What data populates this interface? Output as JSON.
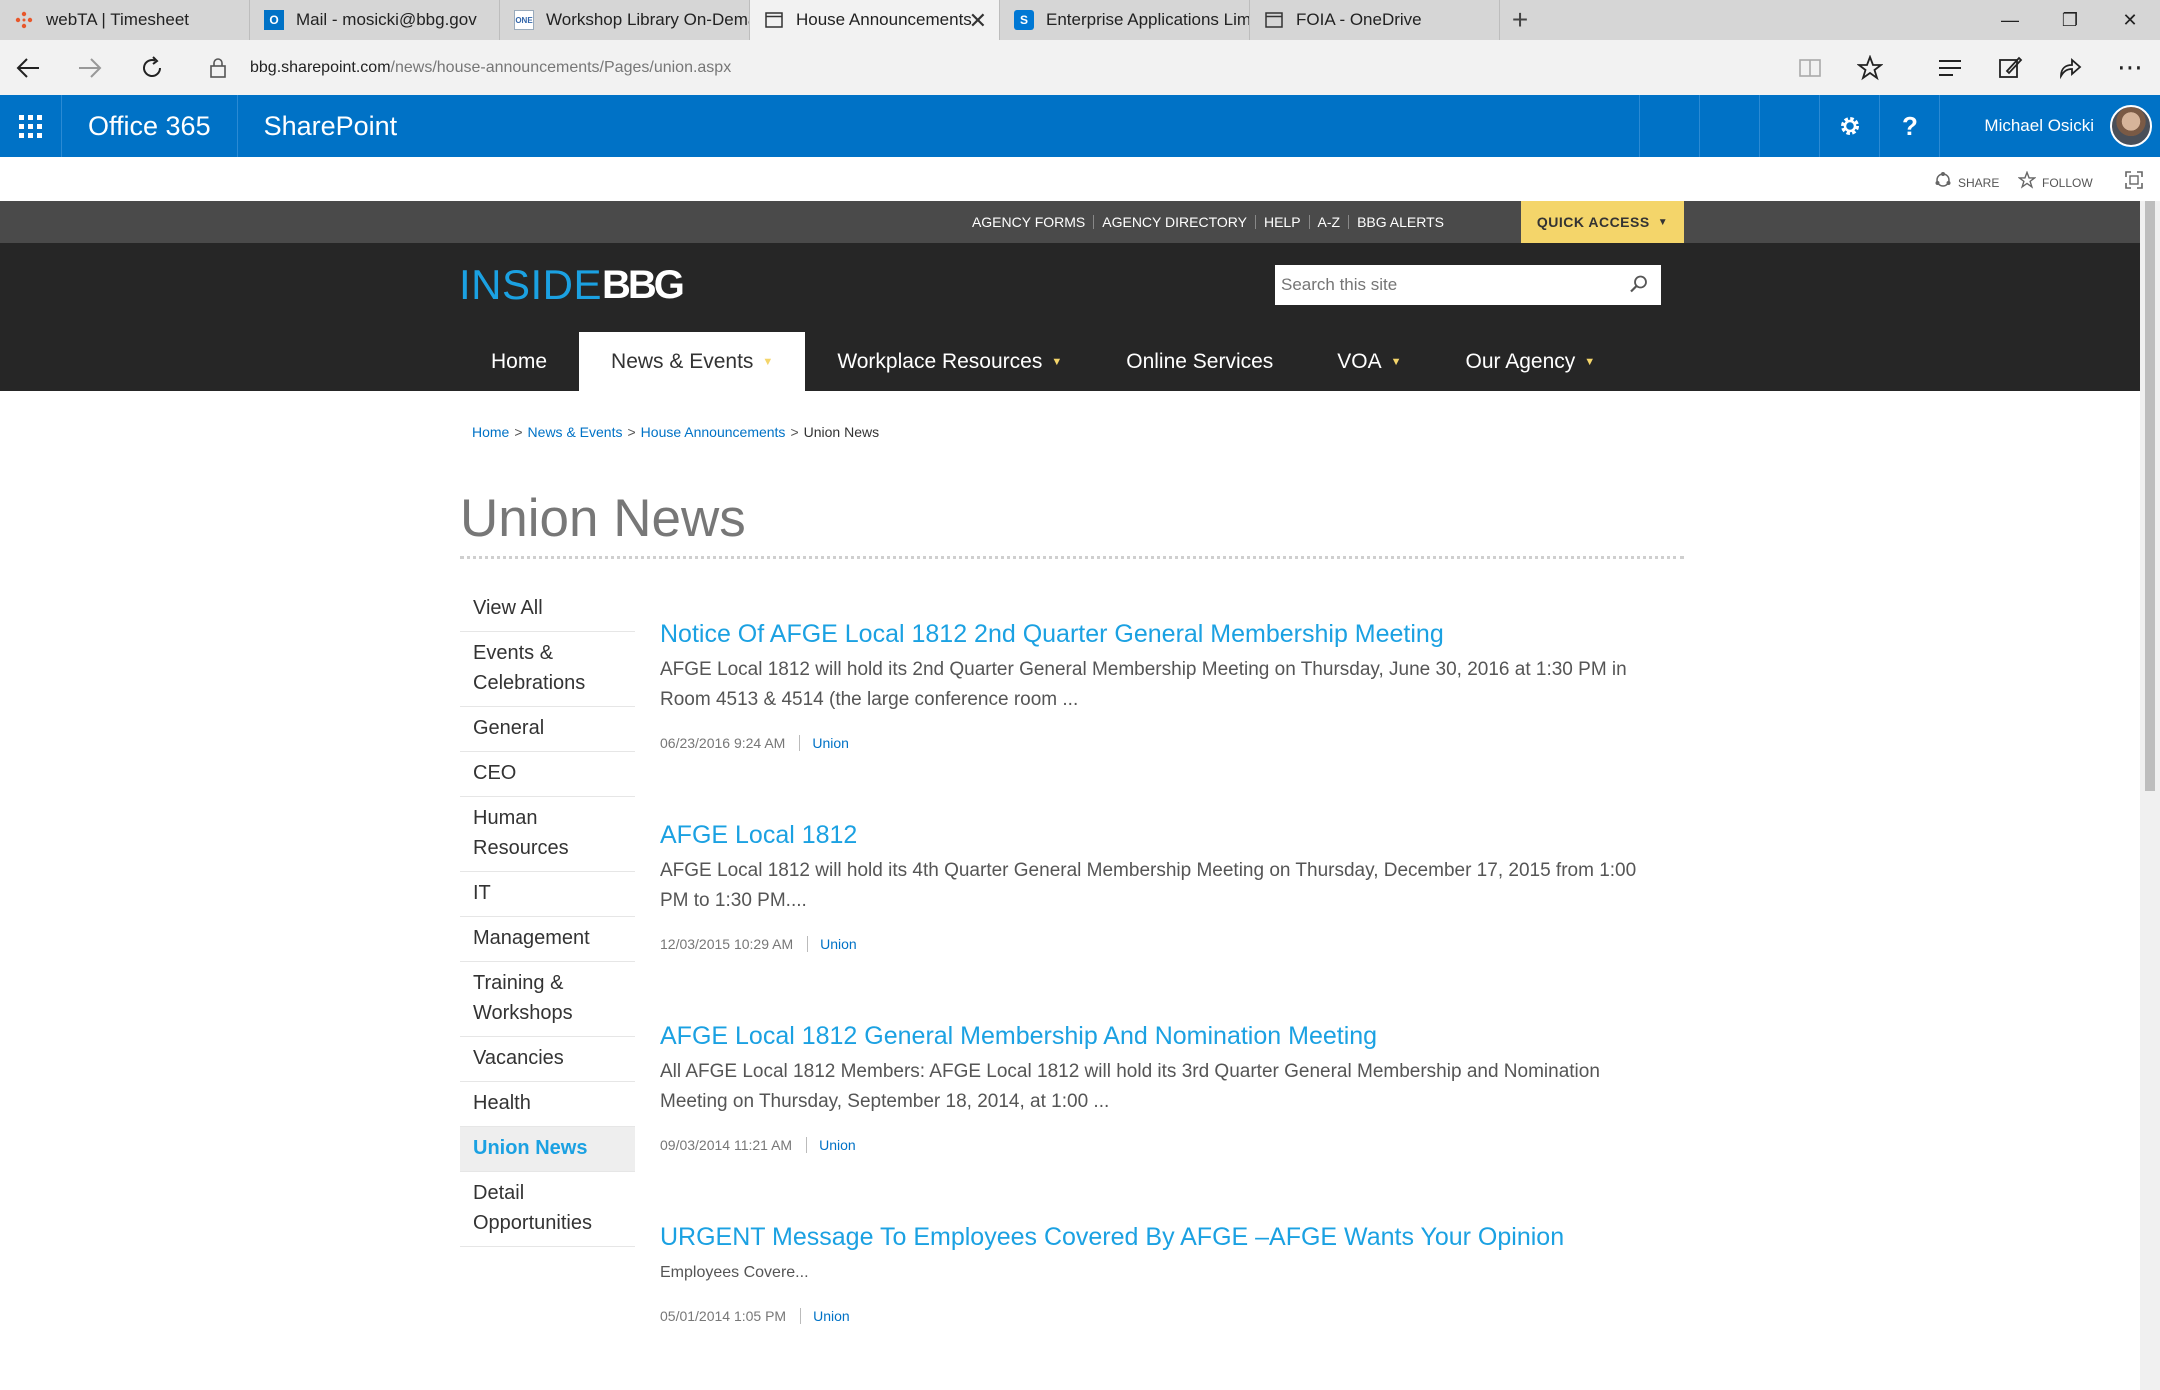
{
  "browser": {
    "tabs": [
      {
        "title": "webTA | Timesheet",
        "icon": "webta-icon",
        "active": false
      },
      {
        "title": "Mail - mosicki@bbg.gov",
        "icon": "outlook-icon",
        "active": false
      },
      {
        "title": "Workshop Library On-Dema",
        "icon": "workshop-icon",
        "active": false
      },
      {
        "title": "House Announcements",
        "icon": "page-icon",
        "active": true
      },
      {
        "title": "Enterprise Applications Limi",
        "icon": "sharepoint-icon",
        "active": false
      },
      {
        "title": "FOIA - OneDrive",
        "icon": "page-icon",
        "active": false
      }
    ],
    "url_domain": "bbg.sharepoint.com",
    "url_path": "/news/house-announcements/Pages/union.aspx"
  },
  "suitebar": {
    "brand": "Office 365",
    "app": "SharePoint",
    "user_name": "Michael Osicki"
  },
  "actionbar": {
    "share": "SHARE",
    "follow": "FOLLOW"
  },
  "utility_links": [
    "AGENCY FORMS",
    "AGENCY DIRECTORY",
    "HELP",
    "A-Z",
    "BBG ALERTS"
  ],
  "quick_access": "QUICK ACCESS",
  "logo": {
    "part1": "INSIDE",
    "part2": "BBG"
  },
  "search": {
    "placeholder": "Search this site"
  },
  "main_nav": [
    {
      "label": "Home",
      "has_menu": false,
      "active": false
    },
    {
      "label": "News & Events",
      "has_menu": true,
      "active": true
    },
    {
      "label": "Workplace Resources",
      "has_menu": true,
      "active": false
    },
    {
      "label": "Online Services",
      "has_menu": false,
      "active": false
    },
    {
      "label": "VOA",
      "has_menu": true,
      "active": false
    },
    {
      "label": "Our Agency",
      "has_menu": true,
      "active": false
    }
  ],
  "breadcrumb": {
    "links": [
      "Home",
      "News & Events",
      "House Announcements"
    ],
    "current": "Union News",
    "separator": ">"
  },
  "page_title": "Union News",
  "left_nav": [
    {
      "label": "View All",
      "active": false
    },
    {
      "label": "Events & Celebrations",
      "active": false
    },
    {
      "label": "General",
      "active": false
    },
    {
      "label": "CEO",
      "active": false
    },
    {
      "label": "Human Resources",
      "active": false
    },
    {
      "label": "IT",
      "active": false
    },
    {
      "label": "Management",
      "active": false
    },
    {
      "label": "Training & Workshops",
      "active": false
    },
    {
      "label": "Vacancies",
      "active": false
    },
    {
      "label": "Health",
      "active": false
    },
    {
      "label": "Union News",
      "active": true
    },
    {
      "label": "Detail Opportunities",
      "active": false
    }
  ],
  "articles": [
    {
      "title": "Notice Of AFGE Local 1812 2nd Quarter General Membership Meeting",
      "summary": "AFGE Local 1812 will hold its 2nd Quarter General Membership Meeting on Thursday, June 30, 2016 at 1:30 PM in Room 4513 & 4514 (the large conference room ...",
      "date": "06/23/2016 9:24 AM",
      "category": "Union"
    },
    {
      "title": "AFGE Local 1812",
      "summary": "AFGE Local 1812 will hold its 4th Quarter General Membership Meeting on Thursday, December 17, 2015 from 1:00 PM to 1:30 PM....",
      "date": "12/03/2015 10:29 AM",
      "category": "Union"
    },
    {
      "title": "AFGE Local 1812 General Membership And Nomination Meeting",
      "summary": "All AFGE Local 1812 Members: AFGE Local 1812 will hold its 3rd Quarter General Membership and Nomination Meeting on Thursday, September 18, 2014, at 1:00 ...",
      "date": "09/03/2014 11:21 AM",
      "category": "Union"
    },
    {
      "title": "URGENT Message To Employees Covered By AFGE –AFGE Wants Your Opinion",
      "summary": "Employees Covere...",
      "date": "05/01/2014 1:05 PM",
      "category": "Union"
    }
  ],
  "colors": {
    "suite_blue": "#0072c6",
    "link_cyan": "#1ba1e2",
    "quick_access_yellow": "#f4d56a",
    "header_dark": "#262626"
  }
}
